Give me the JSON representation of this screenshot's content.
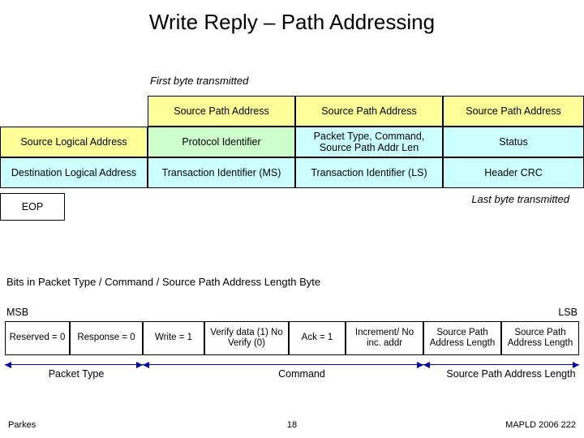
{
  "title": "Write Reply – Path Addressing",
  "first_byte_label": "First byte transmitted",
  "last_byte_label": "Last byte transmitted",
  "packet": {
    "r0": {
      "c1": "Source Path Address",
      "c2": "Source Path Address",
      "c3": "Source Path Address"
    },
    "r1": {
      "c0": "Source Logical Address",
      "c1": "Protocol Identifier",
      "c2": "Packet Type, Command, Source Path Addr Len",
      "c3": "Status"
    },
    "r2": {
      "c0": "Destination Logical Address",
      "c1": "Transaction Identifier (MS)",
      "c2": "Transaction Identifier (LS)",
      "c3": "Header CRC"
    }
  },
  "eop": "EOP",
  "bits_title": "Bits in Packet Type / Command / Source Path Address Length Byte",
  "msb": "MSB",
  "lsb": "LSB",
  "bits": {
    "b0": "Reserved = 0",
    "b1": "Response = 0",
    "b2": "Write = 1",
    "b3": "Verify data (1) No Verify (0)",
    "b4": "Ack = 1",
    "b5": "Increment/ No inc. addr",
    "b6": "Source Path Address Length",
    "b7": "Source Path Address Length"
  },
  "groups": {
    "pkt": "Packet Type",
    "cmd": "Command",
    "spal": "Source Path Address Length"
  },
  "footer": {
    "left": "Parkes",
    "center": "18",
    "right": "MAPLD 2006 222"
  }
}
